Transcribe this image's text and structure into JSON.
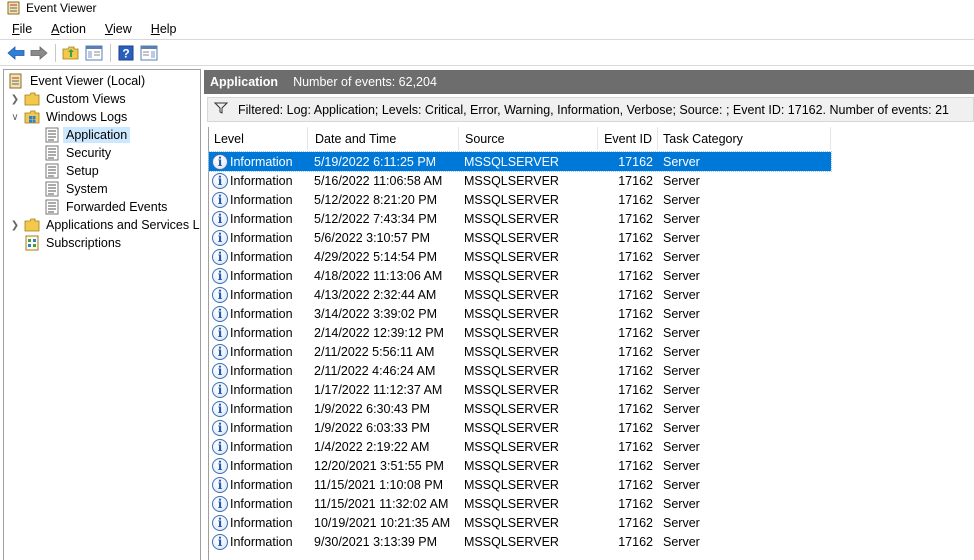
{
  "window": {
    "title": "Event Viewer"
  },
  "menu": [
    {
      "key": "F",
      "rest": "ile"
    },
    {
      "key": "A",
      "rest": "ction"
    },
    {
      "key": "V",
      "rest": "iew"
    },
    {
      "key": "H",
      "rest": "elp"
    }
  ],
  "toolbar": {
    "icons": [
      "back-arrow-icon",
      "forward-arrow-icon",
      "folder-up-icon",
      "show-hide-console-tree-icon",
      "help-icon",
      "show-hide-action-pane-icon"
    ]
  },
  "tree": {
    "root": "Event Viewer (Local)",
    "custom_views": "Custom Views",
    "windows_logs": "Windows Logs",
    "application": "Application",
    "security": "Security",
    "setup": "Setup",
    "system": "System",
    "forwarded_events": "Forwarded Events",
    "apps_services": "Applications and Services Lo",
    "subscriptions": "Subscriptions"
  },
  "header": {
    "title": "Application",
    "count_text": "Number of events: 62,204"
  },
  "filter": {
    "text": "Filtered: Log: Application; Levels: Critical, Error, Warning, Information, Verbose; Source: ; Event ID: 17162. Number of events: 21"
  },
  "columns": {
    "level": "Level",
    "date": "Date and Time",
    "source": "Source",
    "event_id": "Event ID",
    "task": "Task Category"
  },
  "events": [
    {
      "level": "Information",
      "date": "5/19/2022 6:11:25 PM",
      "source": "MSSQLSERVER",
      "id": "17162",
      "task": "Server"
    },
    {
      "level": "Information",
      "date": "5/16/2022 11:06:58 AM",
      "source": "MSSQLSERVER",
      "id": "17162",
      "task": "Server"
    },
    {
      "level": "Information",
      "date": "5/12/2022 8:21:20 PM",
      "source": "MSSQLSERVER",
      "id": "17162",
      "task": "Server"
    },
    {
      "level": "Information",
      "date": "5/12/2022 7:43:34 PM",
      "source": "MSSQLSERVER",
      "id": "17162",
      "task": "Server"
    },
    {
      "level": "Information",
      "date": "5/6/2022 3:10:57 PM",
      "source": "MSSQLSERVER",
      "id": "17162",
      "task": "Server"
    },
    {
      "level": "Information",
      "date": "4/29/2022 5:14:54 PM",
      "source": "MSSQLSERVER",
      "id": "17162",
      "task": "Server"
    },
    {
      "level": "Information",
      "date": "4/18/2022 11:13:06 AM",
      "source": "MSSQLSERVER",
      "id": "17162",
      "task": "Server"
    },
    {
      "level": "Information",
      "date": "4/13/2022 2:32:44 AM",
      "source": "MSSQLSERVER",
      "id": "17162",
      "task": "Server"
    },
    {
      "level": "Information",
      "date": "3/14/2022 3:39:02 PM",
      "source": "MSSQLSERVER",
      "id": "17162",
      "task": "Server"
    },
    {
      "level": "Information",
      "date": "2/14/2022 12:39:12 PM",
      "source": "MSSQLSERVER",
      "id": "17162",
      "task": "Server"
    },
    {
      "level": "Information",
      "date": "2/11/2022 5:56:11 AM",
      "source": "MSSQLSERVER",
      "id": "17162",
      "task": "Server"
    },
    {
      "level": "Information",
      "date": "2/11/2022 4:46:24 AM",
      "source": "MSSQLSERVER",
      "id": "17162",
      "task": "Server"
    },
    {
      "level": "Information",
      "date": "1/17/2022 11:12:37 AM",
      "source": "MSSQLSERVER",
      "id": "17162",
      "task": "Server"
    },
    {
      "level": "Information",
      "date": "1/9/2022 6:30:43 PM",
      "source": "MSSQLSERVER",
      "id": "17162",
      "task": "Server"
    },
    {
      "level": "Information",
      "date": "1/9/2022 6:03:33 PM",
      "source": "MSSQLSERVER",
      "id": "17162",
      "task": "Server"
    },
    {
      "level": "Information",
      "date": "1/4/2022 2:19:22 AM",
      "source": "MSSQLSERVER",
      "id": "17162",
      "task": "Server"
    },
    {
      "level": "Information",
      "date": "12/20/2021 3:51:55 PM",
      "source": "MSSQLSERVER",
      "id": "17162",
      "task": "Server"
    },
    {
      "level": "Information",
      "date": "11/15/2021 1:10:08 PM",
      "source": "MSSQLSERVER",
      "id": "17162",
      "task": "Server"
    },
    {
      "level": "Information",
      "date": "11/15/2021 11:32:02 AM",
      "source": "MSSQLSERVER",
      "id": "17162",
      "task": "Server"
    },
    {
      "level": "Information",
      "date": "10/19/2021 10:21:35 AM",
      "source": "MSSQLSERVER",
      "id": "17162",
      "task": "Server"
    },
    {
      "level": "Information",
      "date": "9/30/2021 3:13:39 PM",
      "source": "MSSQLSERVER",
      "id": "17162",
      "task": "Server"
    }
  ],
  "colors": {
    "selection": "#0078d7",
    "header_bar": "#6d6d6d",
    "tree_selected": "#cce8ff"
  }
}
